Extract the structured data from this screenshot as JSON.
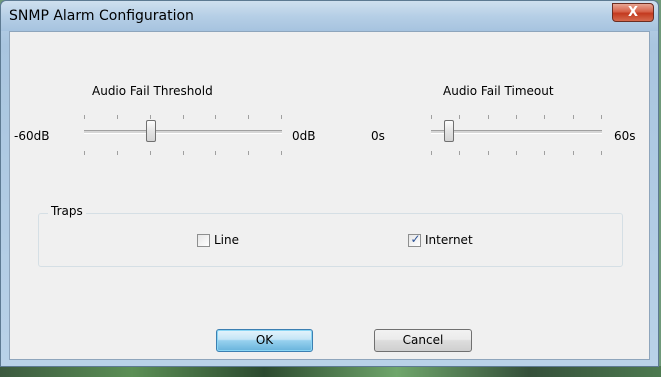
{
  "window": {
    "title": "SNMP Alarm Configuration",
    "close_glyph": "X"
  },
  "threshold": {
    "label": "Audio Fail Threshold",
    "min_label": "-60dB",
    "max_label": "0dB",
    "value_fraction": 0.33
  },
  "timeout": {
    "label": "Audio Fail Timeout",
    "min_label": "0s",
    "max_label": "60s",
    "value_fraction": 0.08
  },
  "traps": {
    "group_label": "Traps",
    "line": {
      "label": "Line",
      "checked": false
    },
    "internet": {
      "label": "Internet",
      "checked": true
    }
  },
  "buttons": {
    "ok_label": "OK",
    "cancel_label": "Cancel"
  },
  "colors": {
    "accent_check": "#2c5296",
    "close_red": "#c33a1f"
  }
}
